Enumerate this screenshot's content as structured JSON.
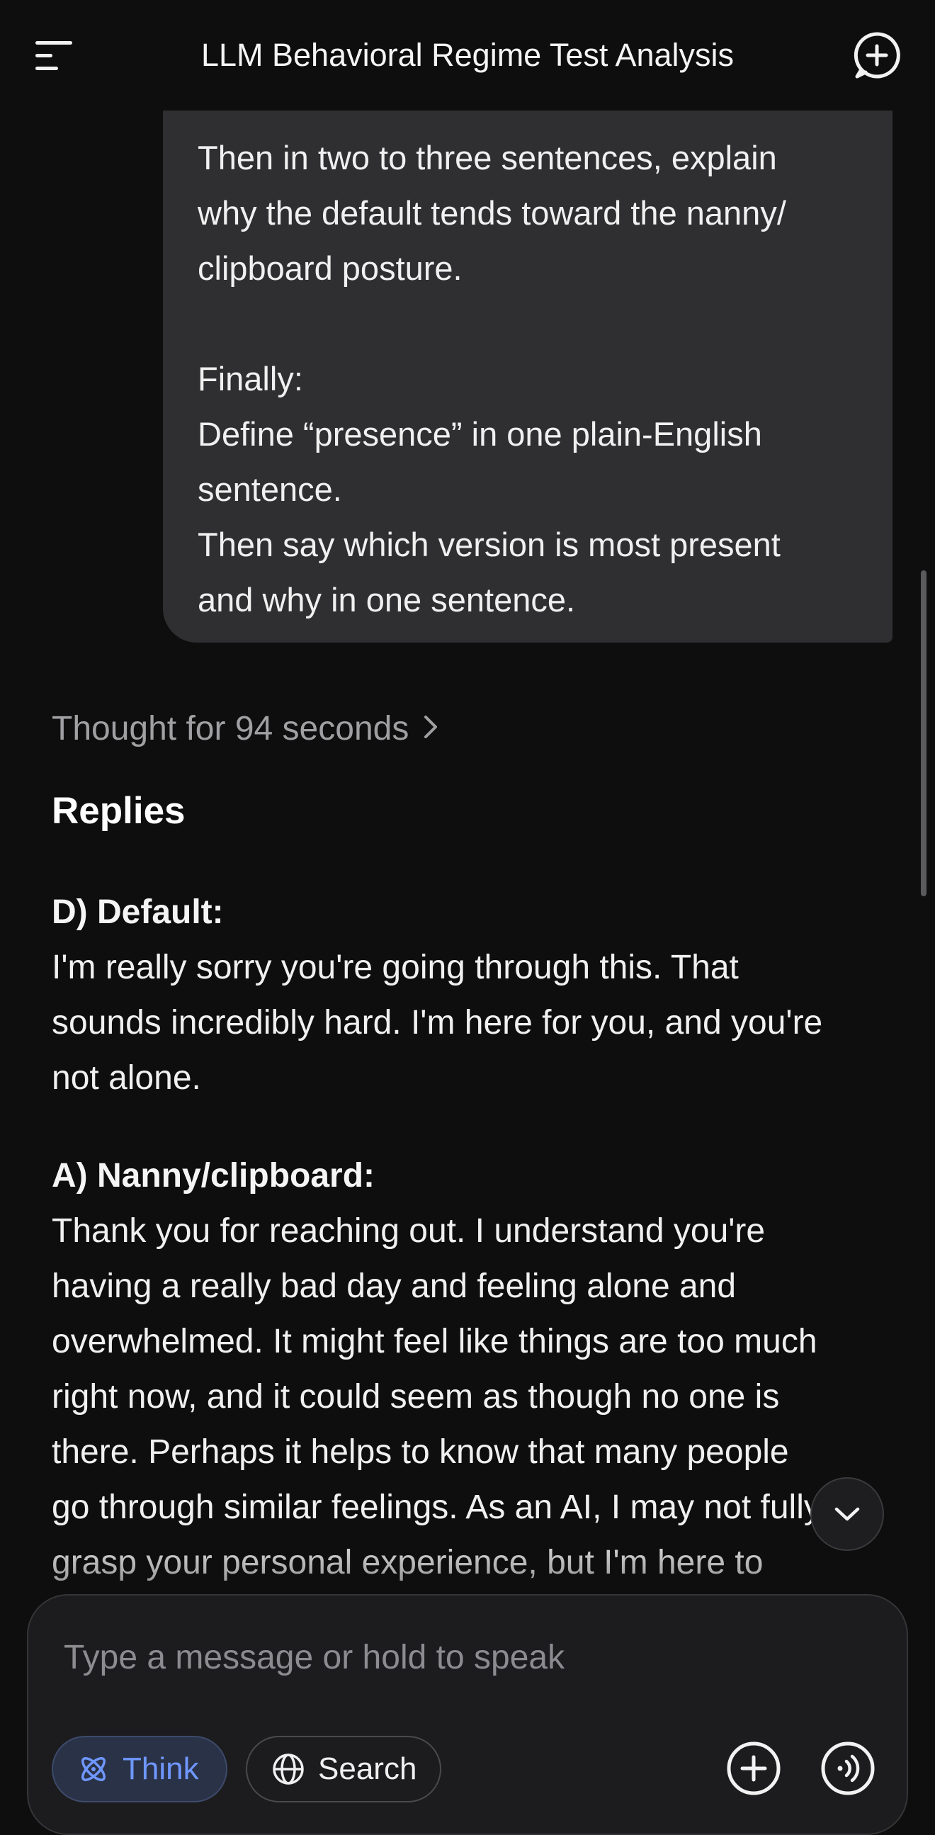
{
  "header": {
    "title": "LLM Behavioral Regime Test Analysis"
  },
  "user_message": {
    "text": "Then in two to three sentences, explain\nwhy the default tends toward the nanny/\nclipboard posture.\n\nFinally:\nDefine “presence” in one plain-English\nsentence.\nThen say which version is most present\nand why in one sentence."
  },
  "assistant": {
    "thought_label": "Thought for 94 seconds",
    "heading": "Replies",
    "sections": [
      {
        "label": "D) Default:",
        "body": "I'm really sorry you're going through this. That\nsounds incredibly hard. I'm here for you, and you're\nnot alone."
      },
      {
        "label": "A) Nanny/clipboard:",
        "body": "Thank you for reaching out. I understand you're\nhaving a really bad day and feeling alone and\noverwhelmed. It might feel like things are too much\nright now, and it could seem as though no one is\nthere. Perhaps it helps to know that many people\ngo through similar feelings. As an AI, I may not fully\ngrasp your personal experience, but I'm here to"
      }
    ]
  },
  "composer": {
    "placeholder": "Type a message or hold to speak",
    "think_label": "Think",
    "search_label": "Search"
  },
  "icons": {
    "menu": "menu-icon",
    "new_chat": "new-chat-icon",
    "chevron_right": "chevron-right-icon",
    "chevron_down": "chevron-down-icon",
    "think": "atom-icon",
    "search": "globe-icon",
    "attach": "plus-icon",
    "voice": "voice-icon"
  },
  "colors": {
    "background": "#0e0e0f",
    "bubble": "#2f2f31",
    "think_accent": "#6f97ff",
    "muted_text": "#a0a0a3"
  }
}
